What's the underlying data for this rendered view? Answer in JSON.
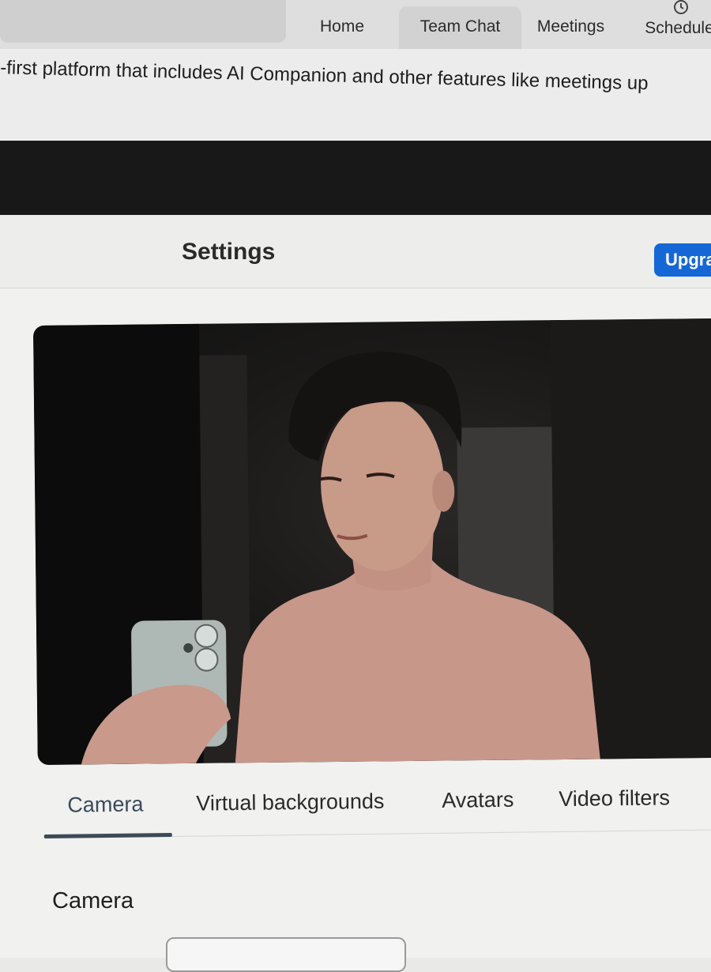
{
  "nav": {
    "items": [
      {
        "label": "Home",
        "icon": "home-icon"
      },
      {
        "label": "Team Chat",
        "icon": "chat-icon"
      },
      {
        "label": "Meetings",
        "icon": "video-icon"
      },
      {
        "label": "Schedule",
        "icon": "clock-icon"
      }
    ]
  },
  "banner": {
    "text": "I-first platform that includes AI Companion and other features like meetings up"
  },
  "settings": {
    "title": "Settings",
    "upgrade_label": "Upgra"
  },
  "video": {
    "content": "camera-preview"
  },
  "tabs": [
    {
      "label": "Camera",
      "active": true
    },
    {
      "label": "Virtual backgrounds",
      "active": false
    },
    {
      "label": "Avatars",
      "active": false
    },
    {
      "label": "Video filters",
      "active": false
    }
  ],
  "camera_section": {
    "heading": "Camera"
  },
  "colors": {
    "accent": "#1667d6",
    "tab_active": "#3b4a57"
  }
}
